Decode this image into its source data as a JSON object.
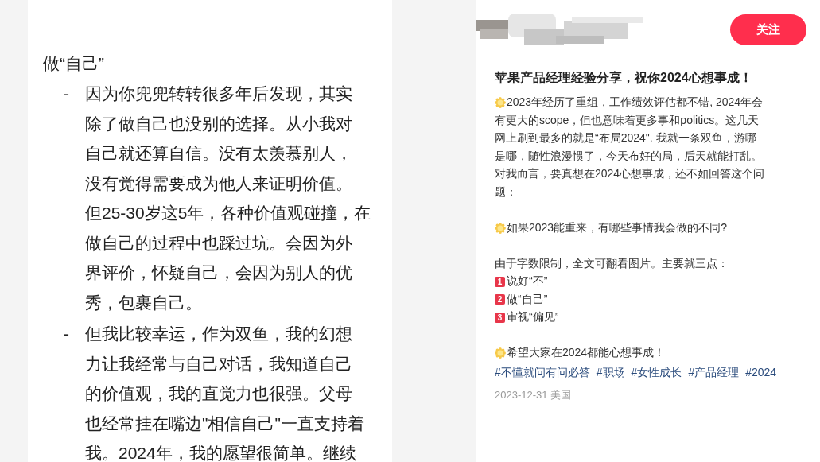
{
  "document": {
    "heading": "做“自己”",
    "bullets": [
      {
        "marker": "-",
        "lines": [
          "因为你兜兜转转很多年后发现，其实",
          "除了做自己也没别的选择。从小我对",
          "自己就还算自信。没有太羡慕别人，",
          "没有觉得需要成为他人来证明价值。",
          "但25-30岁这5年，各种价值观碰撞，在",
          "做自己的过程中也踩过坑。会因为外",
          "界评价，怀疑自己，会因为别人的优",
          "秀，包裹自己。"
        ]
      },
      {
        "marker": "-",
        "lines": [
          "但我比较幸运，作为双鱼，我的幻想",
          "力让我经常与自己对话，我知道自己",
          "的价值观，我的直觉力也很强。父母",
          "也经常挂在嘴边\"相信自己\"一直支持着",
          "我。2024年，我的愿望很简单。继续"
        ]
      }
    ]
  },
  "post": {
    "follow_button": "关注",
    "title": "苹果产品经理经验分享，祝你2024心想事成！",
    "groups": [
      [
        {
          "kind": "sun",
          "lines": [
            "2023年经历了重组，工作绩效评估都不错, 2024年会",
            "有更大的scope，但也意味着更多事和politics。这几天",
            "网上刷到最多的就是“布局2024\". 我就一条双鱼，游哪",
            "是哪，随性浪漫惯了，今天布好的局，后天就能打乱。",
            "对我而言，要真想在2024心想事成，还不如回答这个问",
            "题："
          ]
        }
      ],
      [
        {
          "kind": "sun",
          "lines": [
            "如果2023能重来，有哪些事情我会做的不同?"
          ]
        }
      ],
      [
        {
          "kind": "plain",
          "lines": [
            "由于字数限制，全文可翻看图片。主要就三点："
          ]
        },
        {
          "kind": "number",
          "number": "1",
          "lines": [
            "说好“不”"
          ]
        },
        {
          "kind": "number",
          "number": "2",
          "lines": [
            "做“自己”"
          ]
        },
        {
          "kind": "number",
          "number": "3",
          "lines": [
            "审视“偏见”"
          ]
        }
      ],
      [
        {
          "kind": "sun",
          "lines": [
            "希望大家在2024都能心想事成！"
          ]
        }
      ]
    ],
    "tags": [
      "#不懂就问有问必答",
      "#职场",
      "#女性成长",
      "#产品经理",
      "#2024"
    ],
    "date": "2023-12-31 美国"
  }
}
